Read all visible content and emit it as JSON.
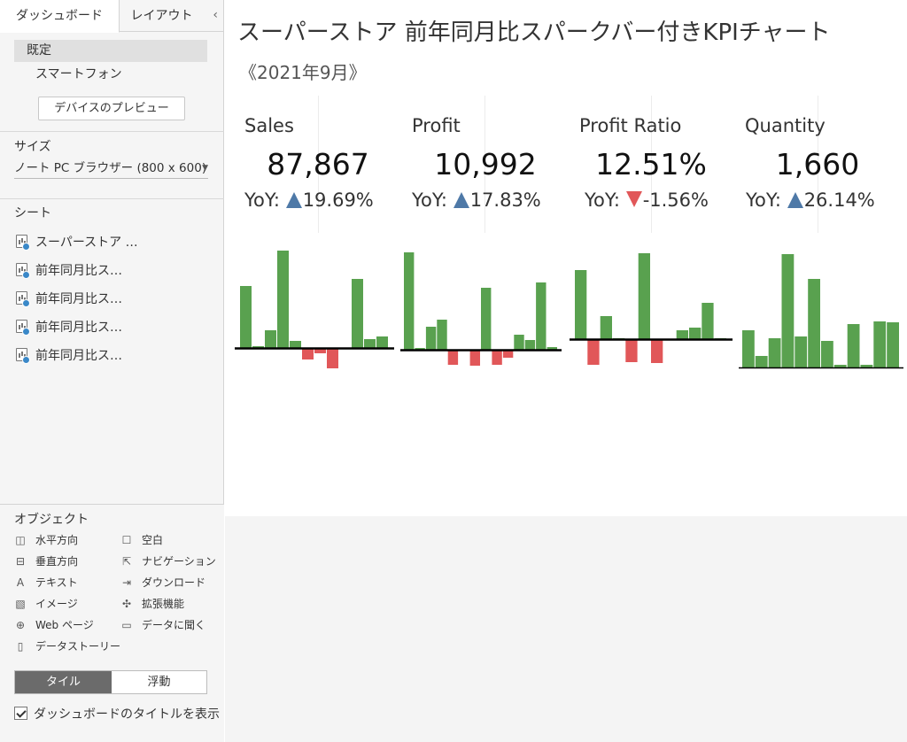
{
  "panel": {
    "tabs": [
      "ダッシュボード",
      "レイアウト"
    ],
    "collapse_icon": "‹",
    "device": {
      "default_label": "既定",
      "phone_label": "スマートフォン",
      "preview_button": "デバイスのプレビュー"
    },
    "size": {
      "title": "サイズ",
      "value": "ノート PC ブラウザー (800 x 600)"
    },
    "sheets": {
      "title": "シート",
      "items": [
        "スーパーストア …",
        "前年同月比ス…",
        "前年同月比ス…",
        "前年同月比ス…",
        "前年同月比ス…"
      ]
    },
    "objects": {
      "title": "オブジェクト",
      "items": [
        {
          "label": "水平方向",
          "icon": "horizontal-layout-icon"
        },
        {
          "label": "空白",
          "icon": "blank-icon"
        },
        {
          "label": "垂直方向",
          "icon": "vertical-layout-icon"
        },
        {
          "label": "ナビゲーション",
          "icon": "navigation-icon"
        },
        {
          "label": "テキスト",
          "icon": "text-icon"
        },
        {
          "label": "ダウンロード",
          "icon": "download-icon"
        },
        {
          "label": "イメージ",
          "icon": "image-icon"
        },
        {
          "label": "拡張機能",
          "icon": "extension-icon"
        },
        {
          "label": "Web ページ",
          "icon": "web-icon"
        },
        {
          "label": "データに聞く",
          "icon": "ask-data-icon"
        },
        {
          "label": "データストーリー",
          "icon": "data-story-icon"
        }
      ]
    },
    "layout_mode": {
      "tiled": "タイル",
      "floating": "浮動",
      "selected": "タイル"
    },
    "show_title": {
      "label": "ダッシュボードのタイトルを表示",
      "checked": true
    }
  },
  "dashboard": {
    "title": "スーパーストア 前年同月比スパークバー付きKPIチャート",
    "subtitle": "《2021年9月》",
    "kpis": [
      {
        "label": "Sales",
        "value": "87,867",
        "yoy_prefix": "YoY: ",
        "yoy": "19.69%",
        "direction": "up"
      },
      {
        "label": "Profit",
        "value": "10,992",
        "yoy_prefix": "YoY: ",
        "yoy": "17.83%",
        "direction": "up"
      },
      {
        "label": "Profit Ratio",
        "value": "12.51%",
        "yoy_prefix": "YoY: ",
        "yoy": "-1.56%",
        "direction": "down"
      },
      {
        "label": "Quantity",
        "value": "1,660",
        "yoy_prefix": "YoY: ",
        "yoy": "26.14%",
        "direction": "up"
      }
    ],
    "colors": {
      "up": "#4e79a7",
      "down": "#e15759",
      "bar_positive": "#59a14f",
      "bar_negative": "#e15759",
      "baseline": "#000000"
    }
  },
  "chart_data": [
    {
      "type": "bar",
      "name": "Sales",
      "values": [
        70,
        2,
        20,
        110,
        8,
        -12,
        -5,
        -22,
        0,
        78,
        10,
        13
      ]
    },
    {
      "type": "bar",
      "name": "Profit",
      "values": [
        110,
        2,
        26,
        34,
        -16,
        0,
        -17,
        70,
        -16,
        -8,
        17,
        11,
        76,
        3
      ]
    },
    {
      "type": "bar",
      "name": "Profit Ratio",
      "values": [
        78,
        -28,
        26,
        1,
        -25,
        97,
        -26,
        0,
        10,
        13,
        41,
        1
      ]
    },
    {
      "type": "bar",
      "name": "Quantity",
      "values": [
        42,
        13,
        33,
        128,
        35,
        100,
        30,
        3,
        49,
        3,
        52,
        51
      ]
    }
  ]
}
